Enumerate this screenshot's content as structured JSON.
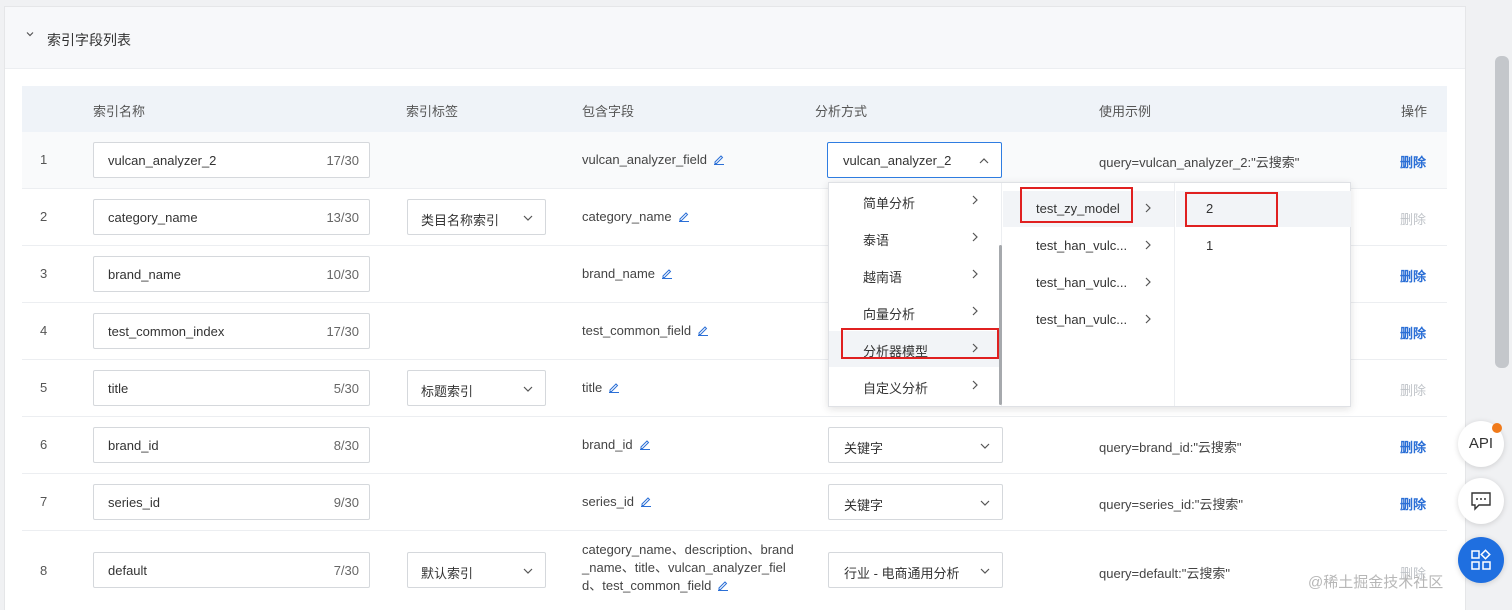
{
  "section_title": "索引字段列表",
  "headers": {
    "name": "索引名称",
    "tag": "索引标签",
    "fields": "包含字段",
    "analyzer": "分析方式",
    "example": "使用示例",
    "op": "操作"
  },
  "rows": [
    {
      "idx": "1",
      "name": "vulcan_analyzer_2",
      "count": "17/30",
      "tag": "",
      "fields": "vulcan_analyzer_field",
      "analyzer": "vulcan_analyzer_2",
      "example": "query=vulcan_analyzer_2:\"云搜索\"",
      "op": "删除"
    },
    {
      "idx": "2",
      "name": "category_name",
      "count": "13/30",
      "tag": "类目名称索引",
      "fields": "category_name",
      "analyzer": "",
      "example": "",
      "op": "删除"
    },
    {
      "idx": "3",
      "name": "brand_name",
      "count": "10/30",
      "tag": "",
      "fields": "brand_name",
      "analyzer": "",
      "example": "",
      "op": "删除"
    },
    {
      "idx": "4",
      "name": "test_common_index",
      "count": "17/30",
      "tag": "",
      "fields": "test_common_field",
      "analyzer": "",
      "example": "",
      "op": "删除"
    },
    {
      "idx": "5",
      "name": "title",
      "count": "5/30",
      "tag": "标题索引",
      "fields": "title",
      "analyzer": "",
      "example": "",
      "op": "删除"
    },
    {
      "idx": "6",
      "name": "brand_id",
      "count": "8/30",
      "tag": "",
      "fields": "brand_id",
      "analyzer": "关键字",
      "example": "query=brand_id:\"云搜索\"",
      "op": "删除"
    },
    {
      "idx": "7",
      "name": "series_id",
      "count": "9/30",
      "tag": "",
      "fields": "series_id",
      "analyzer": "关键字",
      "example": "query=series_id:\"云搜索\"",
      "op": "删除"
    },
    {
      "idx": "8",
      "name": "default",
      "count": "7/30",
      "tag": "默认索引",
      "fields": "category_name、description、brand_name、title、vulcan_analyzer_field、test_common_field",
      "analyzer": "行业 - 电商通用分析",
      "example": "query=default:\"云搜索\"",
      "op": "删除"
    }
  ],
  "cascader": {
    "col1": [
      "简单分析",
      "泰语",
      "越南语",
      "向量分析",
      "分析器模型",
      "自定义分析"
    ],
    "col2": [
      "test_zy_model",
      "test_han_vulc...",
      "test_han_vulc...",
      "test_han_vulc..."
    ],
    "col3": [
      "2",
      "1"
    ]
  },
  "fab": {
    "api": "API"
  },
  "watermark": "@稀土掘金技术社区",
  "colors": {
    "link": "#2b6fd6",
    "highlight": "#e02020",
    "fab_blue": "#1f6fe0"
  }
}
